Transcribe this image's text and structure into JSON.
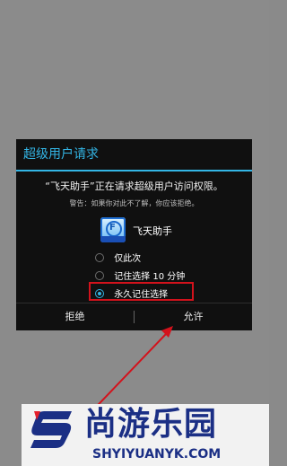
{
  "dialog": {
    "title": "超级用户请求",
    "message": "“飞天助手”正在请求超级用户访问权限。",
    "warning": "警告：如果你对此不了解，你应该拒绝。",
    "app_name": "飞天助手",
    "options": [
      {
        "label": "仅此次",
        "selected": false
      },
      {
        "label": "记住选择 10 分钟",
        "selected": false
      },
      {
        "label": "永久记住选择",
        "selected": true
      }
    ],
    "deny_button": "拒绝",
    "allow_button": "允许"
  },
  "watermark": {
    "title": "尚游乐园",
    "url": "SHYIYUANYK.COM"
  },
  "colors": {
    "accent": "#33b5e5",
    "annotation_red": "#d3121c",
    "dialog_background": "#101010",
    "overlay_background": "#8b8b8b"
  }
}
